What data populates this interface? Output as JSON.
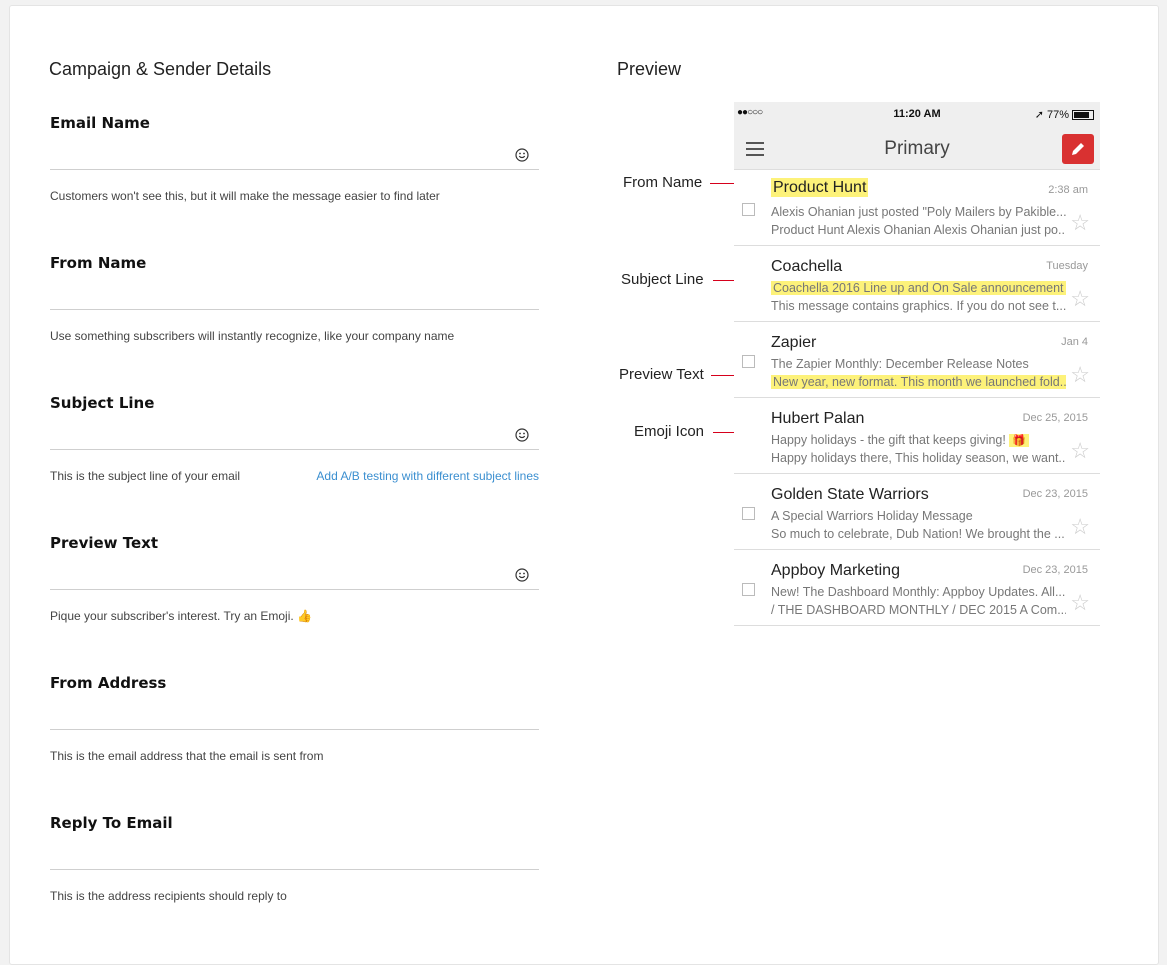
{
  "left": {
    "title": "Campaign & Sender Details",
    "fields": [
      {
        "label": "Email Name",
        "value": "",
        "help": "Customers won't see this, but it will make the message easier to find later",
        "emoji": true
      },
      {
        "label": "From Name",
        "value": "",
        "help": "Use something subscribers will instantly recognize, like your company name",
        "emoji": false
      },
      {
        "label": "Subject Line",
        "value": "",
        "help": "This is the subject line of your email",
        "link": "Add A/B testing with different subject lines",
        "emoji": true
      },
      {
        "label": "Preview Text",
        "value": "",
        "help": "Pique your subscriber's interest. Try an Emoji.",
        "help_icon": "thumbs-up-icon",
        "emoji": true
      },
      {
        "label": "From Address",
        "value": "",
        "help": "This is the email address that the email is sent from",
        "emoji": false
      },
      {
        "label": "Reply To Email",
        "value": "",
        "help": "This is the address recipients should reply to",
        "emoji": false
      }
    ]
  },
  "preview": {
    "title": "Preview",
    "statusbar": {
      "signal": "●●○○○",
      "time": "11:20 AM",
      "battery": "77%"
    },
    "app_title": "Primary",
    "callouts": [
      "From Name",
      "Subject Line",
      "Preview Text",
      "Emoji Icon"
    ],
    "emails": [
      {
        "from": "Product Hunt",
        "date": "2:38 am",
        "line1": "Alexis Ohanian just posted \"Poly Mailers by Pakible...",
        "line2": "Product Hunt Alexis Ohanian Alexis Ohanian just po..."
      },
      {
        "from": "Coachella",
        "date": "Tuesday",
        "line1": "Coachella 2016 Line up and On Sale announcement",
        "line2": "This message contains graphics. If you do not see t..."
      },
      {
        "from": "Zapier",
        "date": "Jan 4",
        "line1": "The Zapier Monthly: December Release Notes",
        "line2": "New year, new format. This month we launched fold..."
      },
      {
        "from": "Hubert Palan",
        "date": "Dec 25, 2015",
        "line1": "Happy holidays - the gift that keeps giving!",
        "line2": "Happy holidays there, This holiday season, we want..."
      },
      {
        "from": "Golden State Warriors",
        "date": "Dec 23, 2015",
        "line1": "A Special Warriors Holiday Message",
        "line2": "So much to celebrate, Dub Nation! We brought the ..."
      },
      {
        "from": "Appboy Marketing",
        "date": "Dec 23, 2015",
        "line1": "New! The Dashboard Monthly: Appboy Updates. All...",
        "line2": "/ THE DASHBOARD MONTHLY / DEC 2015 A Com..."
      }
    ]
  },
  "colors": {
    "accent_link": "#3b8fd0",
    "highlight": "#fdf27a",
    "marker": "#d6001c",
    "compose": "#d93131"
  }
}
